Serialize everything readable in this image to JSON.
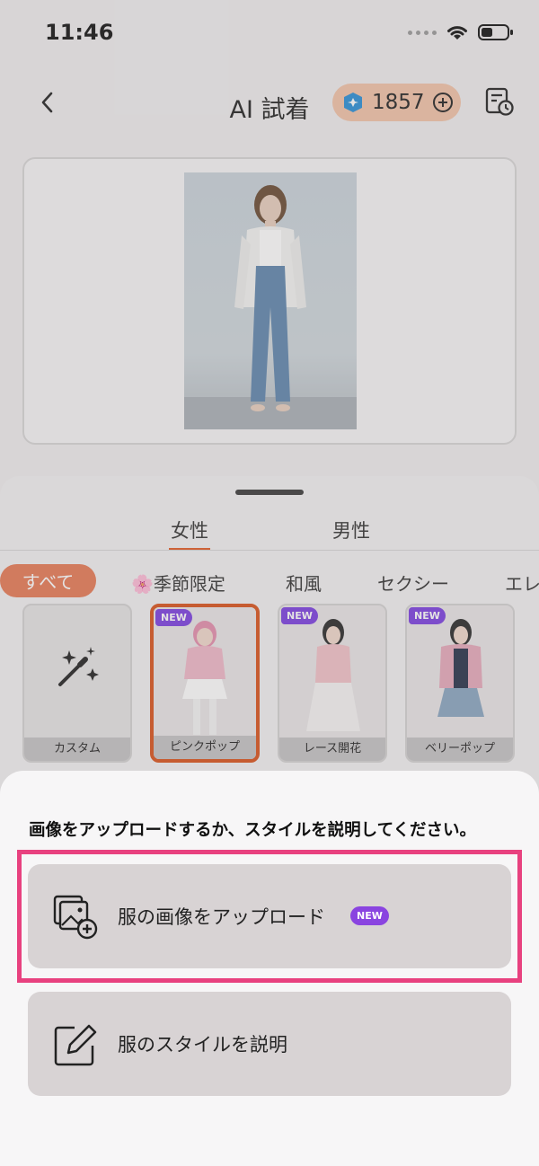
{
  "status_bar": {
    "time": "11:46"
  },
  "header": {
    "title": "AI 試着",
    "credits": "1857"
  },
  "gender_tabs": [
    {
      "label": "女性",
      "active": true
    },
    {
      "label": "男性",
      "active": false
    }
  ],
  "categories": [
    {
      "label": "すべて",
      "active": true
    },
    {
      "label": "🌸季節限定"
    },
    {
      "label": "和風"
    },
    {
      "label": "セクシー"
    },
    {
      "label": "エレ"
    }
  ],
  "styles": [
    {
      "label": "カスタム",
      "badge": ""
    },
    {
      "label": "ピンクポップ",
      "badge": "NEW",
      "selected": true
    },
    {
      "label": "レース開花",
      "badge": "NEW"
    },
    {
      "label": "ベリーポップ",
      "badge": "NEW"
    }
  ],
  "modal": {
    "prompt": "画像をアップロードするか、スタイルを説明してください。",
    "options": [
      {
        "label": "服の画像をアップロード",
        "badge": "NEW",
        "icon": "image-upload-icon"
      },
      {
        "label": "服のスタイルを説明",
        "icon": "edit-icon"
      }
    ]
  },
  "colors": {
    "accent": "#e25a25",
    "highlight_border": "#e8417f",
    "new_badge": "#7b3fe0",
    "credit_pill": "#f2c3a8"
  }
}
